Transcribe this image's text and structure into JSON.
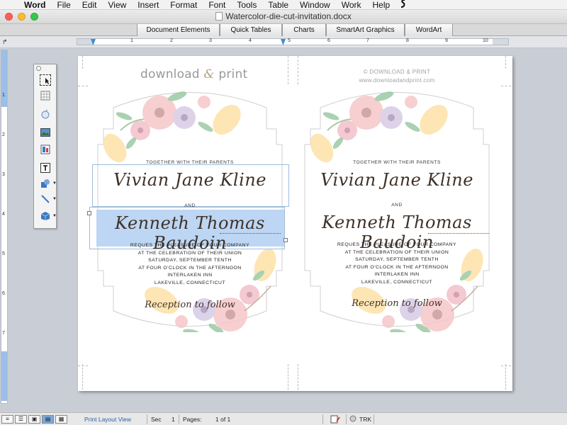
{
  "menubar": {
    "apple": "",
    "app": "Word",
    "items": [
      "File",
      "Edit",
      "View",
      "Insert",
      "Format",
      "Font",
      "Tools",
      "Table",
      "Window",
      "Work",
      "Help"
    ],
    "script_icon": "script-menu-icon"
  },
  "window": {
    "title": "Watercolor-die-cut-invitation.docx"
  },
  "ribbon": {
    "tabs": [
      "Document Elements",
      "Quick Tables",
      "Charts",
      "SmartArt Graphics",
      "WordArt"
    ]
  },
  "ruler": {
    "numbers": [
      "1",
      "2",
      "3",
      "4",
      "5",
      "6",
      "7",
      "8",
      "9",
      "10"
    ],
    "vnumbers": [
      "1",
      "2",
      "3",
      "4",
      "5",
      "6",
      "7"
    ]
  },
  "toolbox": {
    "tools": [
      "select-objects-icon",
      "table-grid-icon",
      "rotate-icon",
      "picture-icon",
      "clip-art-icon",
      "text-box-icon",
      "shapes-icon",
      "line-icon",
      "3d-box-icon"
    ]
  },
  "document": {
    "brand_left_a": "download",
    "brand_left_amp": "&",
    "brand_left_b": "print",
    "brand_right_line1": "© DOWNLOAD & PRINT",
    "brand_right_line2": "www.downloadandprint.com",
    "cards": [
      {
        "together": "TOGETHER WITH THEIR PARENTS",
        "bride": "Vivian Jane Kline",
        "and": "AND",
        "groom": "Kenneth Thomas Baudoin",
        "details": [
          "REQUES THE PLEASURE OF YOUR COMPANY",
          "AT THE CELEBRATION OF THEIR UNION",
          "SATURDAY, SEPTEMBER TENTH",
          "AT FOUR O'CLOCK IN THE AFTERNOON",
          "INTERLAKEN INN",
          "LAKEVILLE, CONNECTICUT"
        ],
        "reception": "Reception to follow"
      },
      {
        "together": "TOGETHER WITH THEIR PARENTS",
        "bride": "Vivian Jane Kline",
        "and": "AND",
        "groom": "Kenneth Thomas Baudoin",
        "details": [
          "REQUES THE PLEASURE OF YOUR COMPANY",
          "AT THE CELEBRATION OF THEIR UNION",
          "SATURDAY, SEPTEMBER TENTH",
          "AT FOUR O'CLOCK IN THE AFTERNOON",
          "INTERLAKEN INN",
          "LAKEVILLE, CONNECTICUT"
        ],
        "reception": "Reception to follow"
      }
    ]
  },
  "statusbar": {
    "view_label": "Print Layout View",
    "sec_label": "Sec",
    "sec_value": "1",
    "pages_label": "Pages:",
    "pages_value": "1 of 1",
    "trk": "TRK"
  },
  "colors": {
    "accent": "#3a8fd8",
    "selection": "#bcd6f3",
    "ink": "#3f3128"
  }
}
